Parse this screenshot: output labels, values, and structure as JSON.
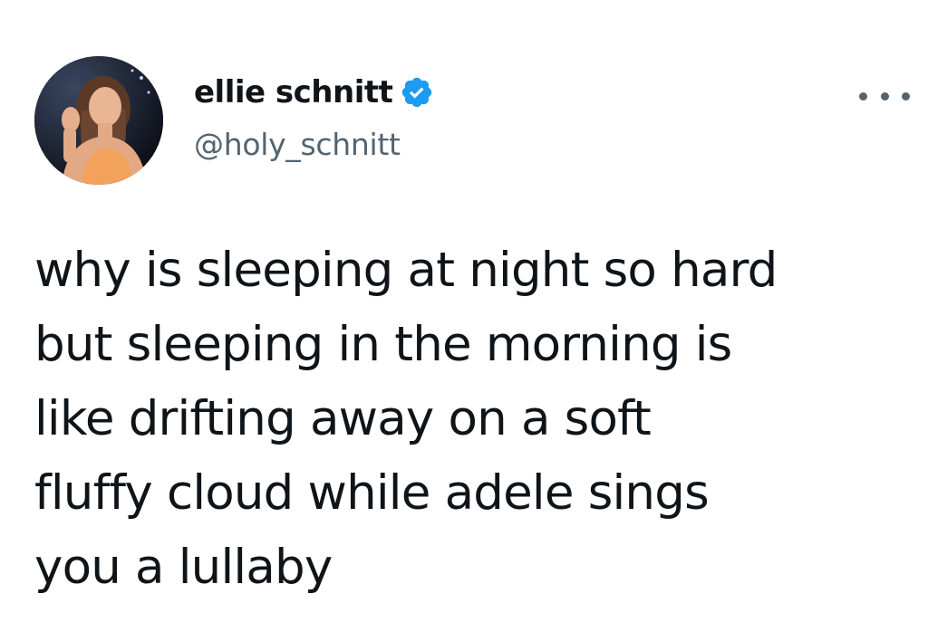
{
  "author": {
    "display_name": "ellie schnitt",
    "handle": "@holy_schnitt",
    "verified": true,
    "avatar_icon": "profile-photo"
  },
  "tweet": {
    "text": "why is sleeping at night so hard\nbut sleeping in the morning is\nlike drifting away on a soft\nfluffy cloud while adele sings\nyou a lullaby"
  },
  "colors": {
    "text": "#0f1419",
    "secondary_text": "#536471",
    "verified_badge": "#1d9bf0",
    "background": "#ffffff"
  },
  "icons": {
    "verified": "verified-badge-icon",
    "more": "more-options-icon"
  }
}
